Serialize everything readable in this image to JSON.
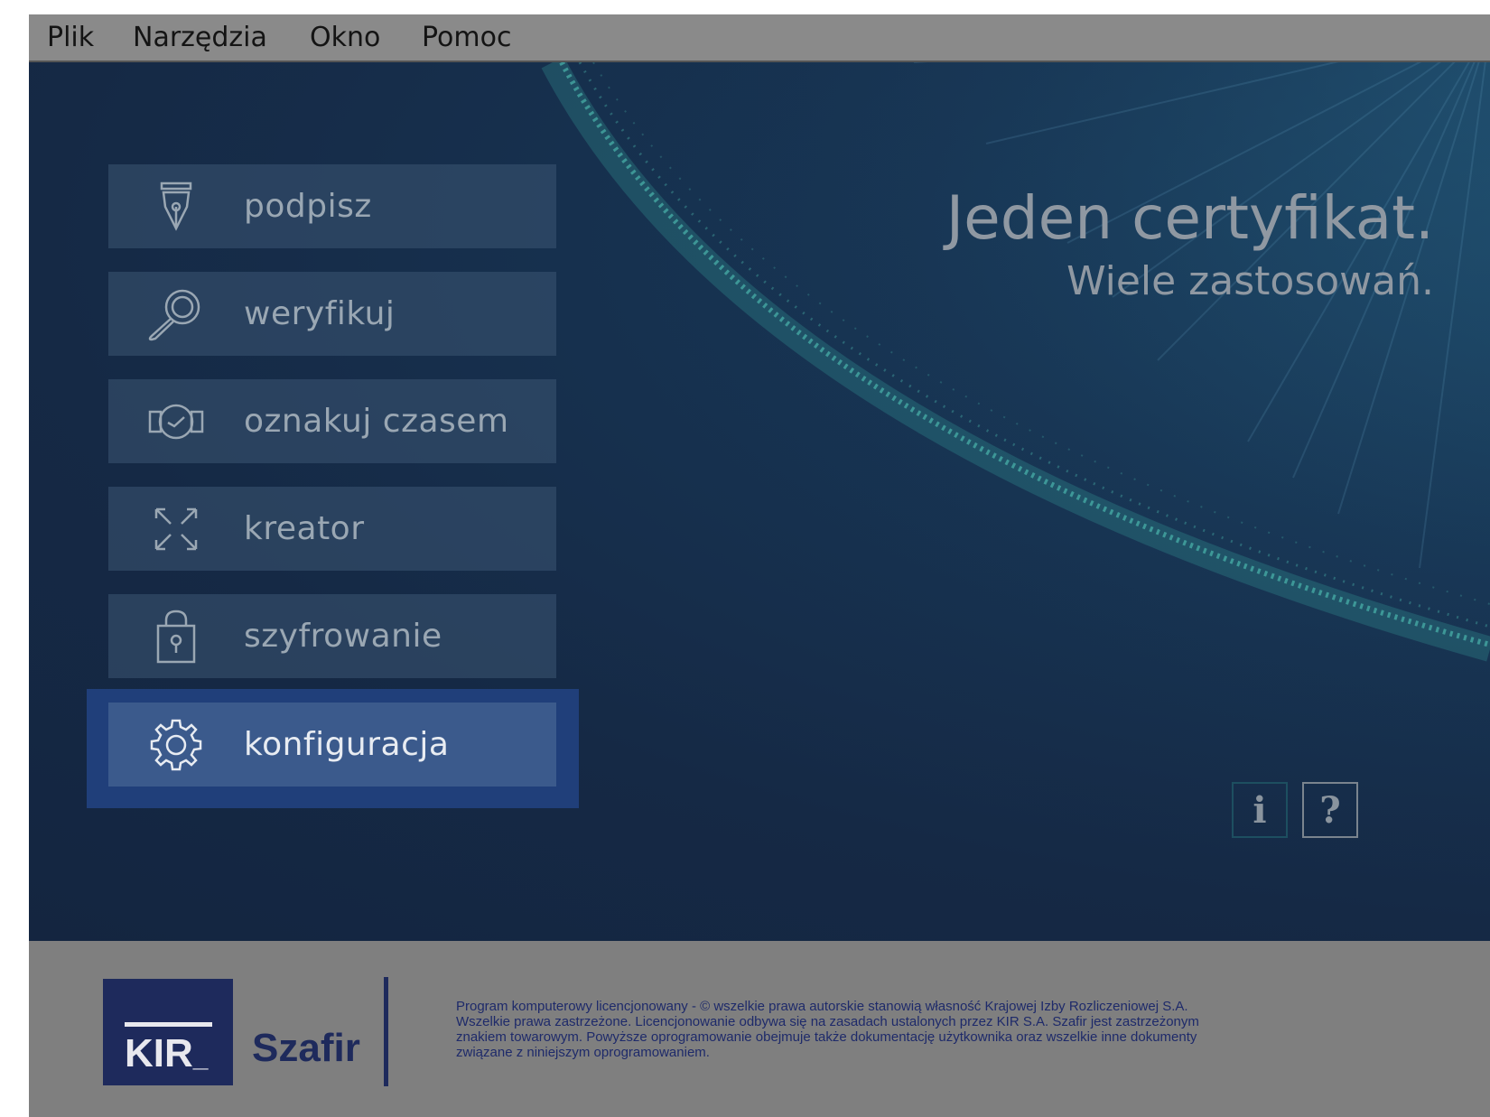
{
  "menu": [
    "Plik",
    "Narzędzia",
    "Okno",
    "Pomoc"
  ],
  "nav": [
    {
      "label": "podpisz",
      "icon": "pen-nib-icon"
    },
    {
      "label": "weryfikuj",
      "icon": "magnifier-icon"
    },
    {
      "label": "oznakuj czasem",
      "icon": "clock-stamp-icon"
    },
    {
      "label": "kreator",
      "icon": "expand-arrows-icon"
    },
    {
      "label": "szyfrowanie",
      "icon": "padlock-icon"
    },
    {
      "label": "konfiguracja",
      "icon": "gear-icon",
      "active": true
    }
  ],
  "tagline": {
    "line1": "Jeden certyfikat.",
    "line2": "Wiele zastosowań."
  },
  "buttons": {
    "info": "i",
    "help": "?"
  },
  "footer": {
    "kir": "KIR",
    "product": "Szafir",
    "legal": [
      "Program komputerowy licencjonowany - © wszelkie prawa autorskie stanowią własność Krajowej Izby Rozliczeniowej S.A.",
      "Wszelkie prawa zastrzeżone. Licencjonowanie odbywa się na zasadach ustalonych przez KIR S.A. Szafir jest zastrzeżonym",
      "znakiem towarowym. Powyższe oprogramowanie obejmuje także dokumentację użytkownika oraz wszelkie inne dokumenty",
      "związane z niniejszym oprogramowaniem."
    ]
  },
  "colors": {
    "active": "#3b5a8c",
    "brand": "#1e2a5c",
    "accent": "#4fc3b5"
  }
}
